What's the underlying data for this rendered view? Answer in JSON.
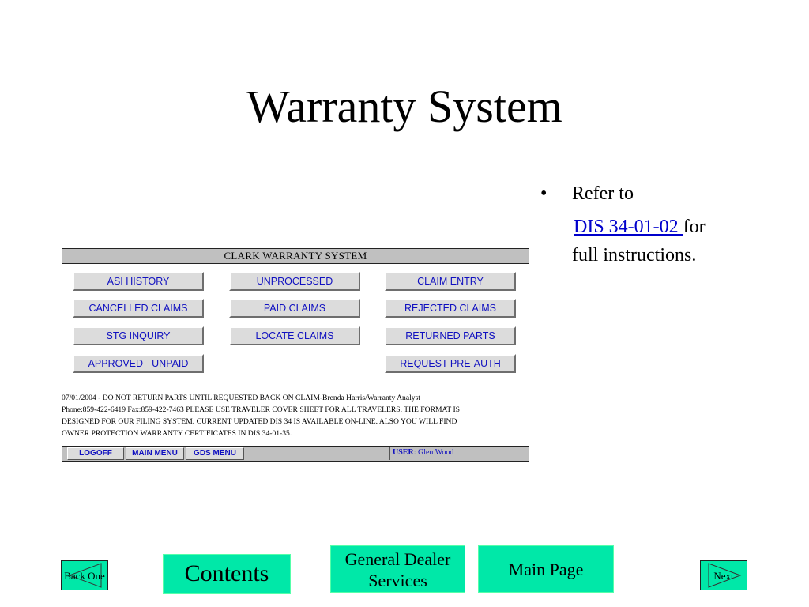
{
  "slide": {
    "title": "Warranty System",
    "bullet": {
      "symbol": "•",
      "text_before": "Refer to",
      "link_text": "DIS 34-01-02 ",
      "text_after": "for",
      "text_line3": "full instructions."
    }
  },
  "warranty_screen": {
    "header": "CLARK WARRANTY SYSTEM",
    "buttons": {
      "asi_history": "ASI HISTORY",
      "unprocessed": "UNPROCESSED",
      "claim_entry": "CLAIM ENTRY",
      "cancelled_claims": "CANCELLED CLAIMS",
      "paid_claims": "PAID CLAIMS",
      "rejected_claims": "REJECTED CLAIMS",
      "stg_inquiry": "STG INQUIRY",
      "locate_claims": "LOCATE CLAIMS",
      "returned_parts": "RETURNED PARTS",
      "approved_unpaid": "APPROVED - UNPAID",
      "request_pre_auth": "REQUEST PRE-AUTH"
    },
    "message_lines": [
      "07/01/2004 - DO NOT RETURN PARTS UNTIL REQUESTED BACK ON CLAIM-Brenda Harris/Warranty Analyst",
      "Phone:859-422-6419 Fax:859-422-7463 PLEASE USE TRAVELER COVER SHEET FOR ALL TRAVELERS. THE FORMAT IS",
      "DESIGNED FOR OUR FILING SYSTEM. CURRENT UPDATED DIS 34 IS AVAILABLE ON-LINE. ALSO YOU WILL FIND",
      "OWNER PROTECTION WARRANTY CERTIFICATES IN DIS 34-01-35."
    ],
    "footer": {
      "logoff": "LOGOFF",
      "main_menu": "MAIN MENU",
      "gds_menu": "GDS MENU",
      "user_label": "USER",
      "user_value": ": Glen Wood"
    }
  },
  "nav": {
    "back_one": "Back One",
    "contents": "Contents",
    "general_dealer_line1": "General Dealer",
    "general_dealer_line2": "Services",
    "main_page": "Main Page",
    "next": "Next"
  },
  "colors": {
    "nav_green": "#00e8a8",
    "link_blue": "#0000cc",
    "screen_gray": "#c0c0c0",
    "button_text_blue": "#1010c0"
  }
}
